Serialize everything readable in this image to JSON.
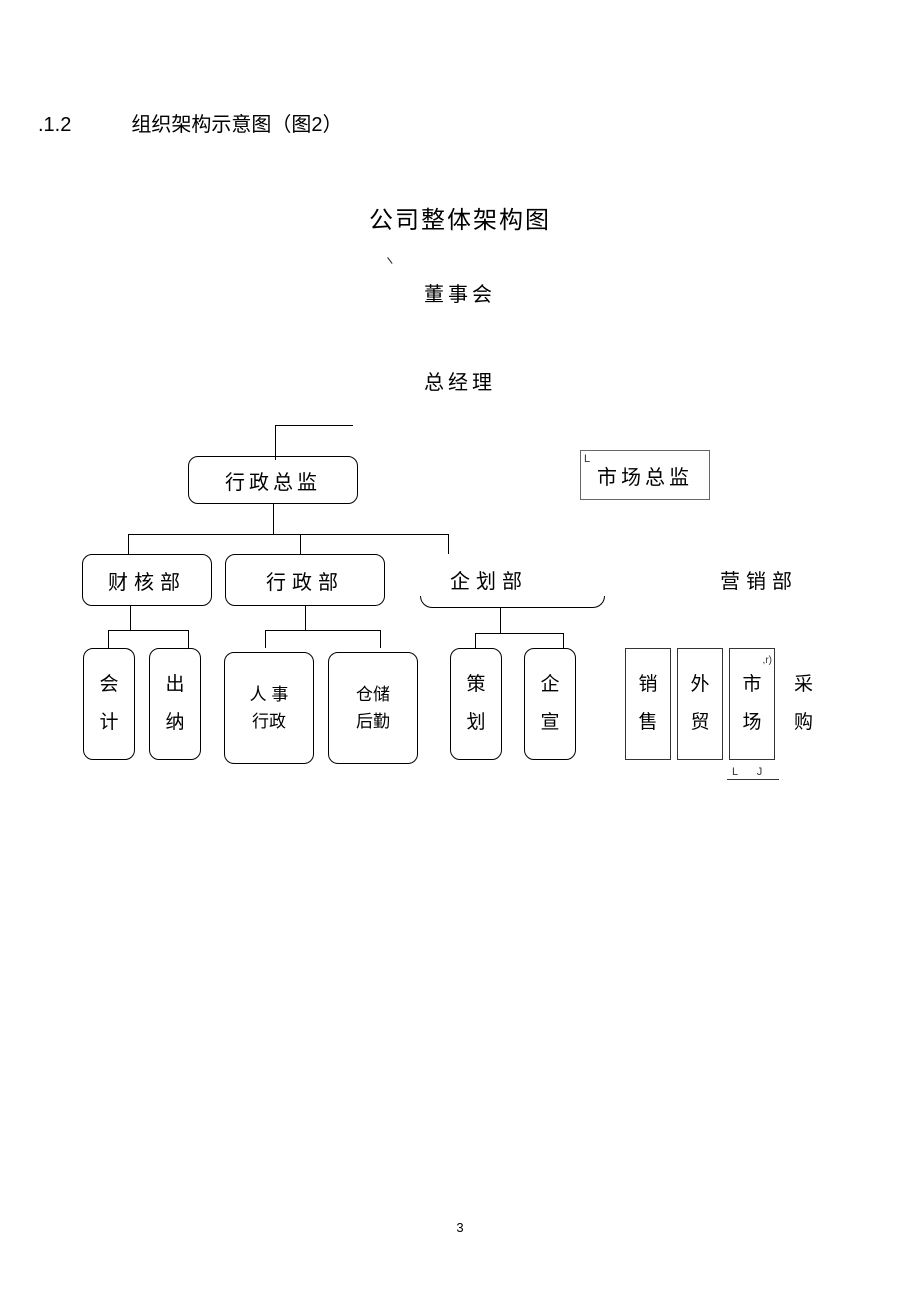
{
  "section": {
    "number": ".1.2",
    "title": "组织架构示意图（图",
    "fig_num": "2",
    "close": "）"
  },
  "main_title": "公司整体架构图",
  "board": "董事会",
  "gm": "总经理",
  "directors": {
    "admin": "行政总监",
    "market": "市场总监"
  },
  "depts": {
    "finaudit": "财核部",
    "admin": "行政部",
    "planning": "企划部",
    "sales": "营销部"
  },
  "leaves": {
    "accounting": "会计",
    "cashier": "出纳",
    "hr_admin": "人事行政",
    "warehouse": "仓储后勤",
    "plan": "策划",
    "publicity": "企宣",
    "sales": "销售",
    "foreign": "外贸",
    "market": "市场",
    "procure": "采购"
  },
  "marks": {
    "corner_l": "L",
    "corner_r": ",r)",
    "lj": "L  J",
    "tl": ""
  },
  "page_number": "3"
}
